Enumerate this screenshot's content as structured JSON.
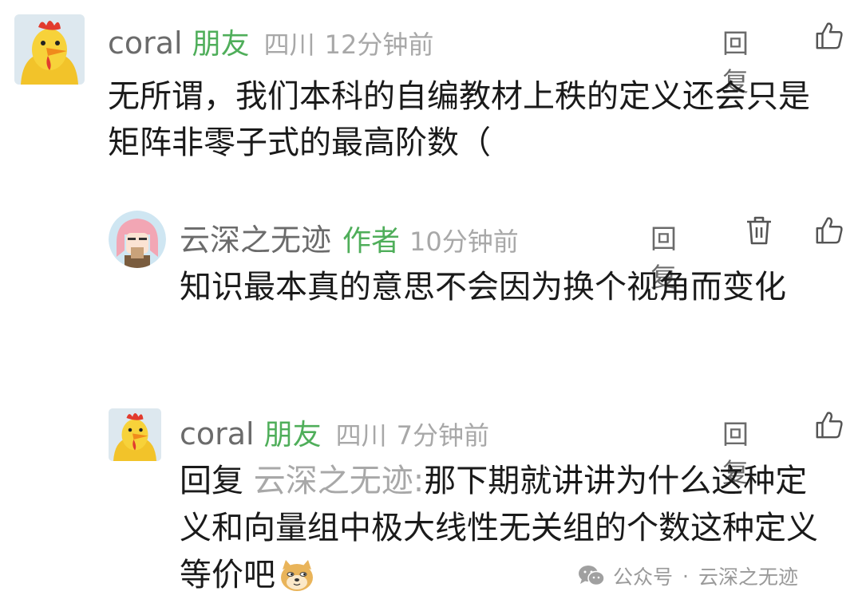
{
  "comments": [
    {
      "name": "coral",
      "tag": "朋友",
      "location": "四川",
      "time": "12分钟前",
      "reply_label": "回复",
      "text": "无所谓，我们本科的自编教材上秩的定义还会只是矩阵非零子式的最高阶数（",
      "avatar_icon": "rooster-avatar"
    },
    {
      "name": "云深之无迹",
      "tag": "作者",
      "time": "10分钟前",
      "reply_label": "回复",
      "text": "知识最本真的意思不会因为换个视角而变化",
      "avatar_icon": "girl-avatar"
    },
    {
      "name": "coral",
      "tag": "朋友",
      "location": "四川",
      "time": "7分钟前",
      "reply_label": "回复",
      "reply_prefix": "回复",
      "reply_target": "云深之无迹:",
      "text": "那下期就讲讲为什么这种定义和向量组中极大线性无关组的个数这种定义等价吧",
      "emoji": "doge-emoji",
      "avatar_icon": "rooster-avatar"
    }
  ],
  "watermark": {
    "label": "公众号",
    "separator": "·",
    "account": "云深之无迹"
  },
  "colors": {
    "tag_green": "#4fae5a",
    "meta_gray": "#a8a8a8",
    "name_gray": "#6b6b6b"
  }
}
